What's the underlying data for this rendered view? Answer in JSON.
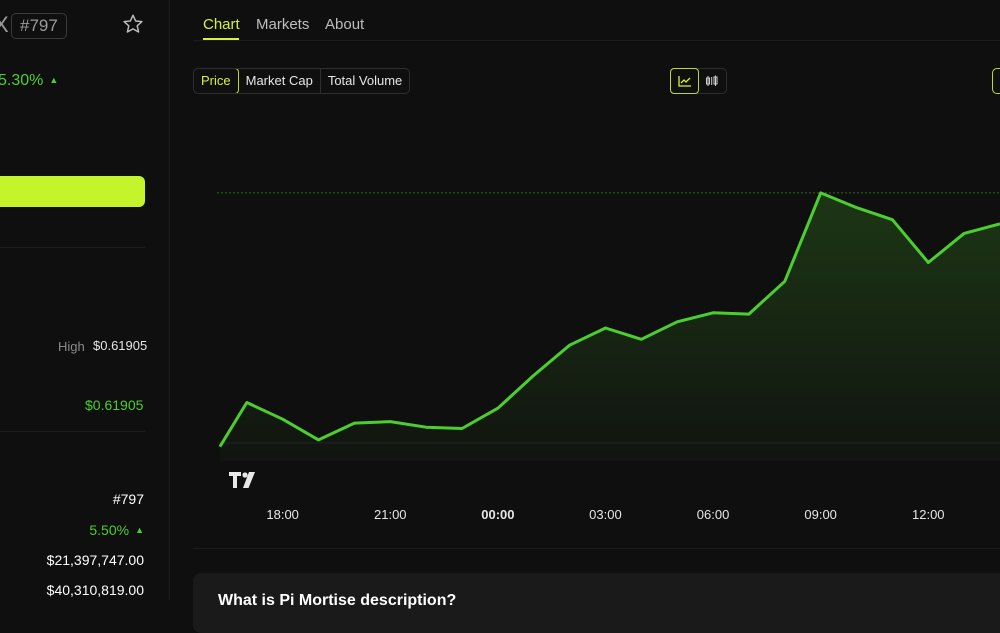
{
  "header": {
    "rank_badge": "#797",
    "price_change": "5.30%",
    "price_change_dir": "▲"
  },
  "stats": {
    "high_label": "High",
    "high_value": "$0.61905",
    "green_value": "$0.61905",
    "rank": "#797",
    "change": "5.50%",
    "change_dir": "▲",
    "market_cap": "$21,397,747.00",
    "volume": "$40,310,819.00"
  },
  "tabs": [
    {
      "label": "Chart",
      "active": true
    },
    {
      "label": "Markets",
      "active": false
    },
    {
      "label": "About",
      "active": false
    }
  ],
  "segmented": [
    {
      "label": "Price",
      "active": true
    },
    {
      "label": "Market Cap",
      "active": false
    },
    {
      "label": "Total Volume",
      "active": false
    }
  ],
  "chart_type_icons": [
    "line-chart-icon",
    "candlestick-icon"
  ],
  "colors": {
    "accent": "#d7f23e",
    "line": "#4ccf2e",
    "cta": "#c4f52a",
    "background": "#0f0f0f"
  },
  "chart_data": {
    "type": "area",
    "x_ticks": [
      "18:00",
      "21:00",
      "00:00",
      "03:00",
      "06:00",
      "09:00",
      "12:00"
    ],
    "x_tick_bold": [
      false,
      false,
      true,
      false,
      false,
      false,
      false
    ],
    "x": [
      16.25,
      17.0,
      18.0,
      19.0,
      20.0,
      21.0,
      22.0,
      23.0,
      24.0,
      25.0,
      26.0,
      27.0,
      28.0,
      29.0,
      30.0,
      31.0,
      32.0,
      33.0,
      34.0,
      35.0,
      36.0,
      37.0,
      38.0
    ],
    "y": [
      0.16,
      1.87,
      1.22,
      0.42,
      1.07,
      1.13,
      0.91,
      0.86,
      1.65,
      2.92,
      4.09,
      4.76,
      4.32,
      5.0,
      5.35,
      5.3,
      6.57,
      10.0,
      9.43,
      8.96,
      7.3,
      8.43,
      8.8
    ],
    "x_range": [
      15.5,
      38.0
    ],
    "y_range": [
      -0.4,
      10.5
    ],
    "reference_line_y": 10.0,
    "grid": "horizontal"
  },
  "about": {
    "title": "What is Pi Mortise description?"
  }
}
